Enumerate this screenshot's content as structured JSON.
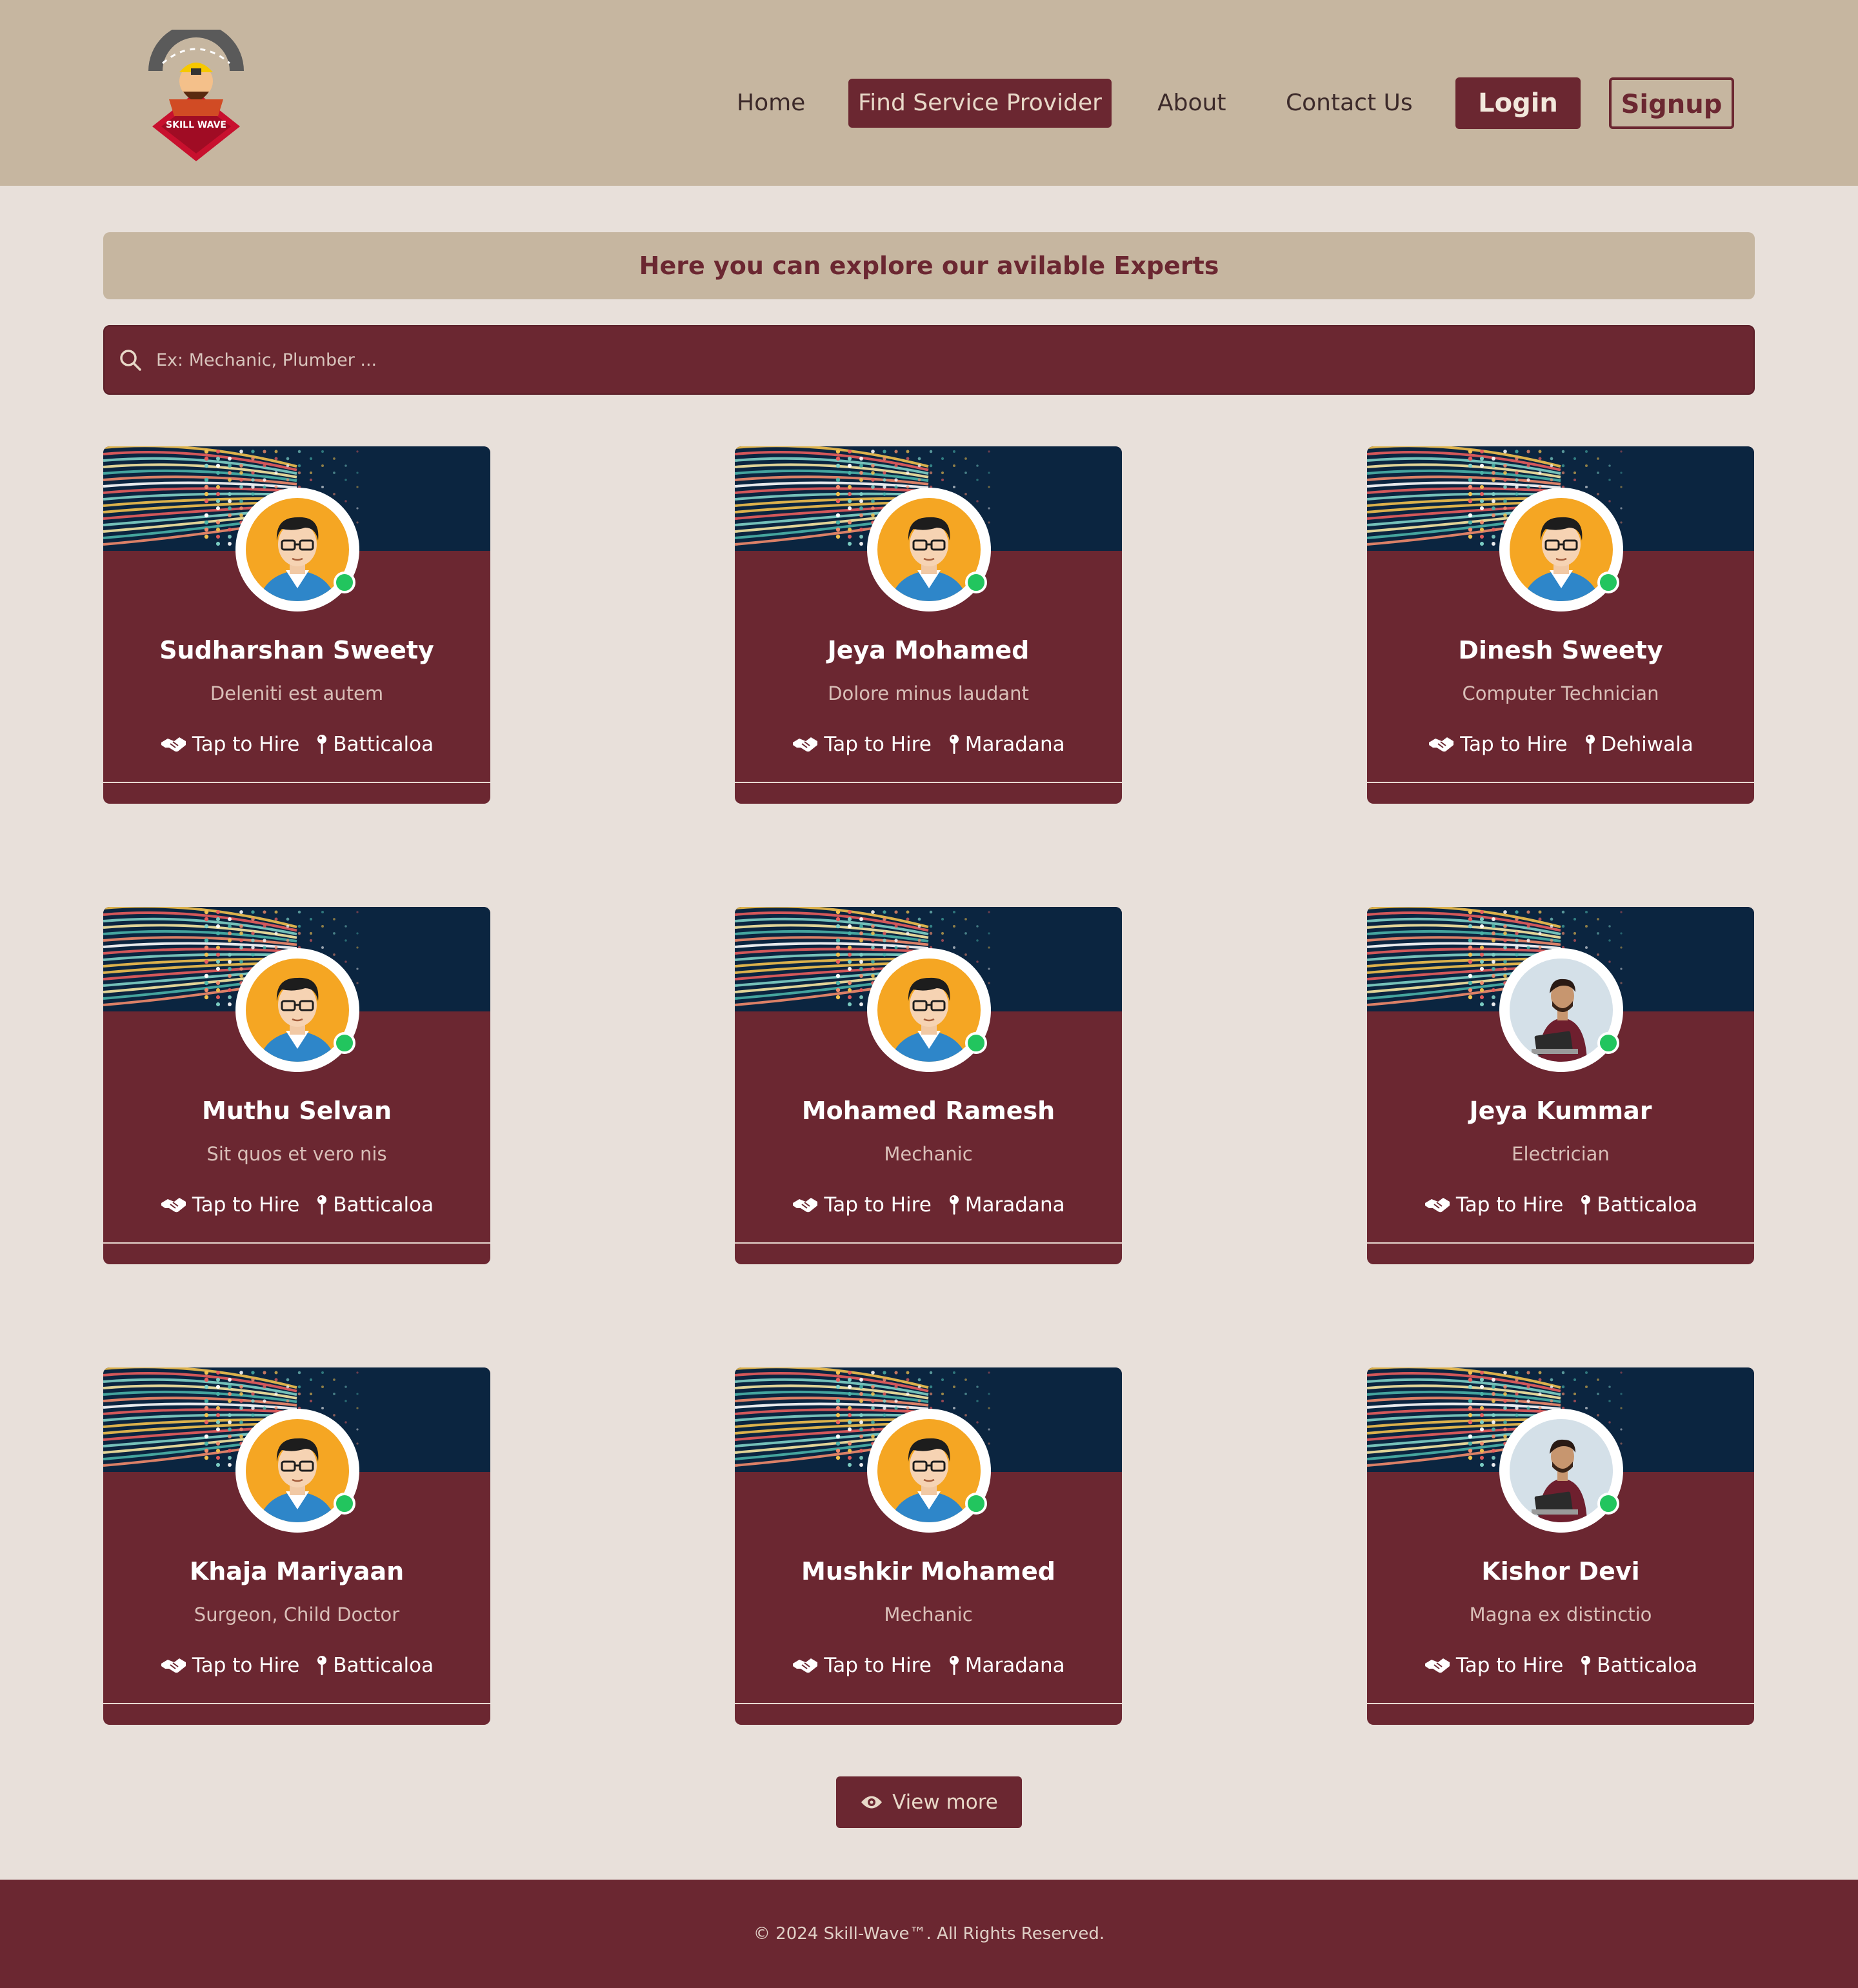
{
  "nav": {
    "home": "Home",
    "find_service_provider": "Find Service Provider",
    "about": "About",
    "contact_us": "Contact Us",
    "login": "Login",
    "signup": "Signup"
  },
  "logo": {
    "text": "SKILL WAVE"
  },
  "banner": {
    "title": "Here you can explore our avilable Experts"
  },
  "search": {
    "placeholder": "Ex: Mechanic, Plumber ..."
  },
  "experts": [
    {
      "name": "Sudharshan Sweety",
      "role": "Deleniti est autem",
      "hire_label": "Tap to Hire",
      "location": "Batticaloa",
      "avatar": "cartoon-avatar",
      "status": "online"
    },
    {
      "name": "Jeya Mohamed",
      "role": "Dolore minus laudant",
      "hire_label": "Tap to Hire",
      "location": "Maradana",
      "avatar": "cartoon-avatar",
      "status": "online"
    },
    {
      "name": "Dinesh Sweety",
      "role": "Computer Technician",
      "hire_label": "Tap to Hire",
      "location": "Dehiwala",
      "avatar": "cartoon-avatar",
      "status": "online"
    },
    {
      "name": "Muthu Selvan",
      "role": "Sit quos et vero nis",
      "hire_label": "Tap to Hire",
      "location": "Batticaloa",
      "avatar": "cartoon-avatar",
      "status": "online"
    },
    {
      "name": "Mohamed Ramesh",
      "role": "Mechanic",
      "hire_label": "Tap to Hire",
      "location": "Maradana",
      "avatar": "cartoon-avatar",
      "status": "online"
    },
    {
      "name": "Jeya Kummar",
      "role": "Electrician",
      "hire_label": "Tap to Hire",
      "location": "Batticaloa",
      "avatar": "photo-avatar",
      "status": "online"
    },
    {
      "name": "Khaja Mariyaan",
      "role": "Surgeon, Child Doctor",
      "hire_label": "Tap to Hire",
      "location": "Batticaloa",
      "avatar": "cartoon-avatar",
      "status": "online"
    },
    {
      "name": "Mushkir Mohamed",
      "role": "Mechanic",
      "hire_label": "Tap to Hire",
      "location": "Maradana",
      "avatar": "cartoon-avatar",
      "status": "online"
    },
    {
      "name": "Kishor Devi",
      "role": "Magna ex distinctio",
      "hire_label": "Tap to Hire",
      "location": "Batticaloa",
      "avatar": "photo-avatar",
      "status": "online"
    }
  ],
  "view_more": {
    "label": "View more"
  },
  "footer": {
    "copyright": "© 2024 Skill-Wave™. All Rights Reserved."
  },
  "colors": {
    "header_bg": "#c6b6a0",
    "page_bg": "#e8e0da",
    "maroon": "#6b2731",
    "online": "#22c55e",
    "cover_navy": "#0b2540"
  }
}
